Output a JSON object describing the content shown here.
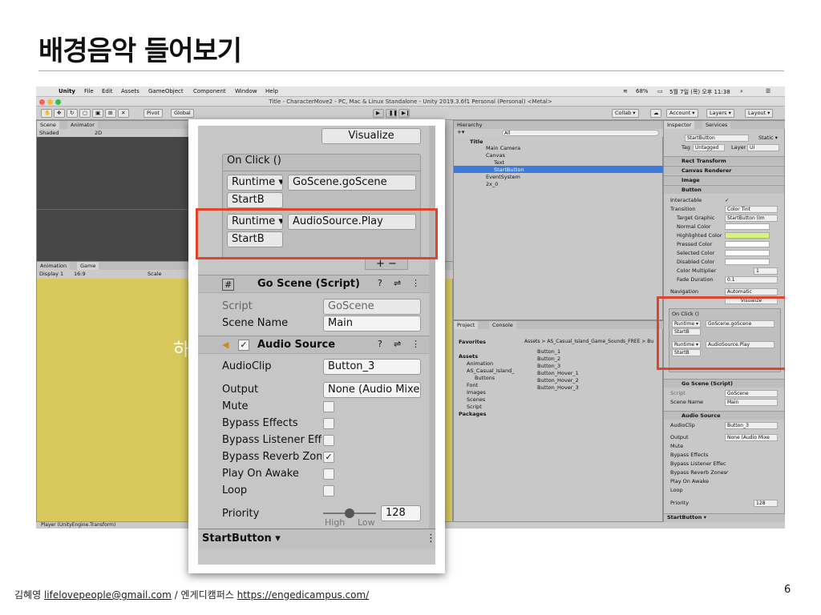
{
  "slide": {
    "title": "배경음악 들어보기",
    "footer_author": "김혜영",
    "footer_email": "lifelovepeople@gmail.com",
    "footer_sep": "/",
    "footer_org": "엔게디캠퍼스",
    "footer_url": "https://engedicampus.com/",
    "page_number": "6"
  },
  "menubar": {
    "app": "Unity",
    "items": [
      "File",
      "Edit",
      "Assets",
      "GameObject",
      "Component",
      "Window",
      "Help"
    ],
    "battery": "68%",
    "datetime": "5월 7일 (목) 오후 11:38"
  },
  "window_title": "Title - CharacterMove2 - PC, Mac & Linux Standalone - Unity 2019.3.6f1 Personal (Personal) <Metal>",
  "toolbar": {
    "pivot": "Pivot",
    "global": "Global",
    "collab": "Collab ▾",
    "account": "Account ▾",
    "layers": "Layers ▾",
    "layout": "Layout ▾"
  },
  "scene": {
    "tab_scene": "Scene",
    "tab_animator": "Animator",
    "shaded": "Shaded",
    "mode2d": "2D"
  },
  "game": {
    "tab_animation": "Animation",
    "tab_game": "Game",
    "display": "Display 1",
    "aspect": "16:9",
    "scale": "Scale",
    "text_fragment": "하"
  },
  "hierarchy": {
    "tab": "Hierarchy",
    "search": "All",
    "items": [
      "Title",
      "Main Camera",
      "Canvas",
      "Text",
      "StartButton",
      "EventSystem",
      "2x_0"
    ]
  },
  "project": {
    "tab_project": "Project",
    "tab_console": "Console",
    "tree": [
      "Favorites",
      "Assets",
      "Animation",
      "AS_Casual_Island_",
      "Buttons",
      "Font",
      "Images",
      "Scenes",
      "Script",
      "Packages"
    ],
    "breadcrumb": "Assets > AS_Casual_Island_Game_Sounds_FREE > Bu",
    "files": [
      "Button_1",
      "Button_2",
      "Button_3",
      "Button_Hover_1",
      "Button_Hover_2",
      "Button_Hover_3"
    ]
  },
  "inspector": {
    "tab_inspector": "Inspector",
    "tab_services": "Services",
    "object_name": "StartButton",
    "static": "Static ▾",
    "tag_label": "Tag",
    "tag_value": "Untagged",
    "layer_label": "Layer",
    "layer_value": "UI",
    "components": [
      "Rect Transform",
      "Canvas Renderer",
      "Image",
      "Button"
    ],
    "button_props": [
      {
        "label": "Interactable",
        "value": "✓"
      },
      {
        "label": "Transition",
        "value": "Color Tint"
      },
      {
        "label": "Target Graphic",
        "value": "StartButton (Im"
      },
      {
        "label": "Normal Color",
        "value": ""
      },
      {
        "label": "Highlighted Color",
        "value": ""
      },
      {
        "label": "Pressed Color",
        "value": ""
      },
      {
        "label": "Selected Color",
        "value": ""
      },
      {
        "label": "Disabled Color",
        "value": ""
      },
      {
        "label": "Color Multiplier",
        "value": "1"
      },
      {
        "label": "Fade Duration",
        "value": "0.1"
      }
    ],
    "navigation_label": "Navigation",
    "navigation_value": "Automatic",
    "visualize": "Visualize",
    "onclick": "On Click ()",
    "runtime": "Runtime ▾",
    "fn1": "GoScene.goScene",
    "fn2": "AudioSource.Play",
    "target": "StartB",
    "goscene_title": "Go Scene (Script)",
    "script_label": "Script",
    "script_value": "GoScene",
    "scene_name_label": "Scene Name",
    "scene_name_value": "Main",
    "audio_title": "Audio Source",
    "audio_props": [
      {
        "label": "AudioClip",
        "value": "Button_3"
      },
      {
        "label": "Output",
        "value": "None (Audio Mixe"
      },
      {
        "label": "Mute",
        "value": ""
      },
      {
        "label": "Bypass Effects",
        "value": ""
      },
      {
        "label": "Bypass Listener Effec",
        "value": ""
      },
      {
        "label": "Bypass Reverb Zones",
        "value": "✓"
      },
      {
        "label": "Play On Awake",
        "value": ""
      },
      {
        "label": "Loop",
        "value": ""
      }
    ],
    "priority_label": "Priority",
    "priority_value": "128",
    "priority_fraction": 0.5,
    "high": "High",
    "low": "Low",
    "footer_object": "StartButton ▾"
  },
  "statusbar": "Player (UnityEngine.Transform)",
  "colors": {
    "game_bg": "#d9c95c",
    "highlight_row": "#3e7bd6",
    "red_box": "#e0452b",
    "highlighted_color": "#d9f27a"
  }
}
